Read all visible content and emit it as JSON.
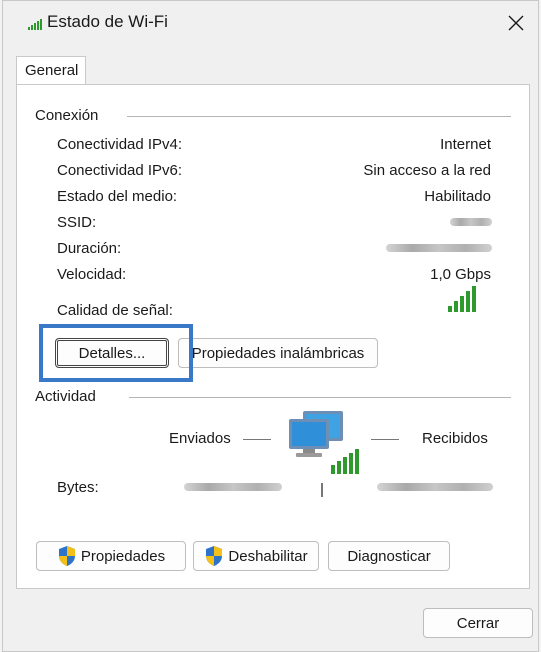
{
  "window": {
    "title": "Estado de Wi-Fi"
  },
  "tabs": [
    {
      "label": "General"
    }
  ],
  "connection": {
    "section_title": "Conexión",
    "rows": [
      {
        "label": "Conectividad IPv4:",
        "value": "Internet"
      },
      {
        "label": "Conectividad IPv6:",
        "value": "Sin acceso a la red"
      },
      {
        "label": "Estado del medio:",
        "value": "Habilitado"
      },
      {
        "label": "SSID:",
        "value": ""
      },
      {
        "label": "Duración:",
        "value": ""
      },
      {
        "label": "Velocidad:",
        "value": "1,0 Gbps"
      }
    ],
    "signal_label": "Calidad de señal:",
    "details_button": "Detalles...",
    "wireless_props_button": "Propiedades inalámbricas"
  },
  "activity": {
    "section_title": "Actividad",
    "sent_label": "Enviados",
    "received_label": "Recibidos",
    "bytes_label": "Bytes:"
  },
  "buttons": {
    "properties": "Propiedades",
    "disable": "Deshabilitar",
    "diagnose": "Diagnosticar",
    "close": "Cerrar"
  },
  "icons": {
    "title": "wifi-signal-icon",
    "close": "close-icon",
    "signal": "signal-strength-icon",
    "network": "network-computers-icon",
    "shield": "uac-shield-icon"
  },
  "colors": {
    "signal_green": "#2e9a2e",
    "highlight_blue": "#3a78c8"
  }
}
